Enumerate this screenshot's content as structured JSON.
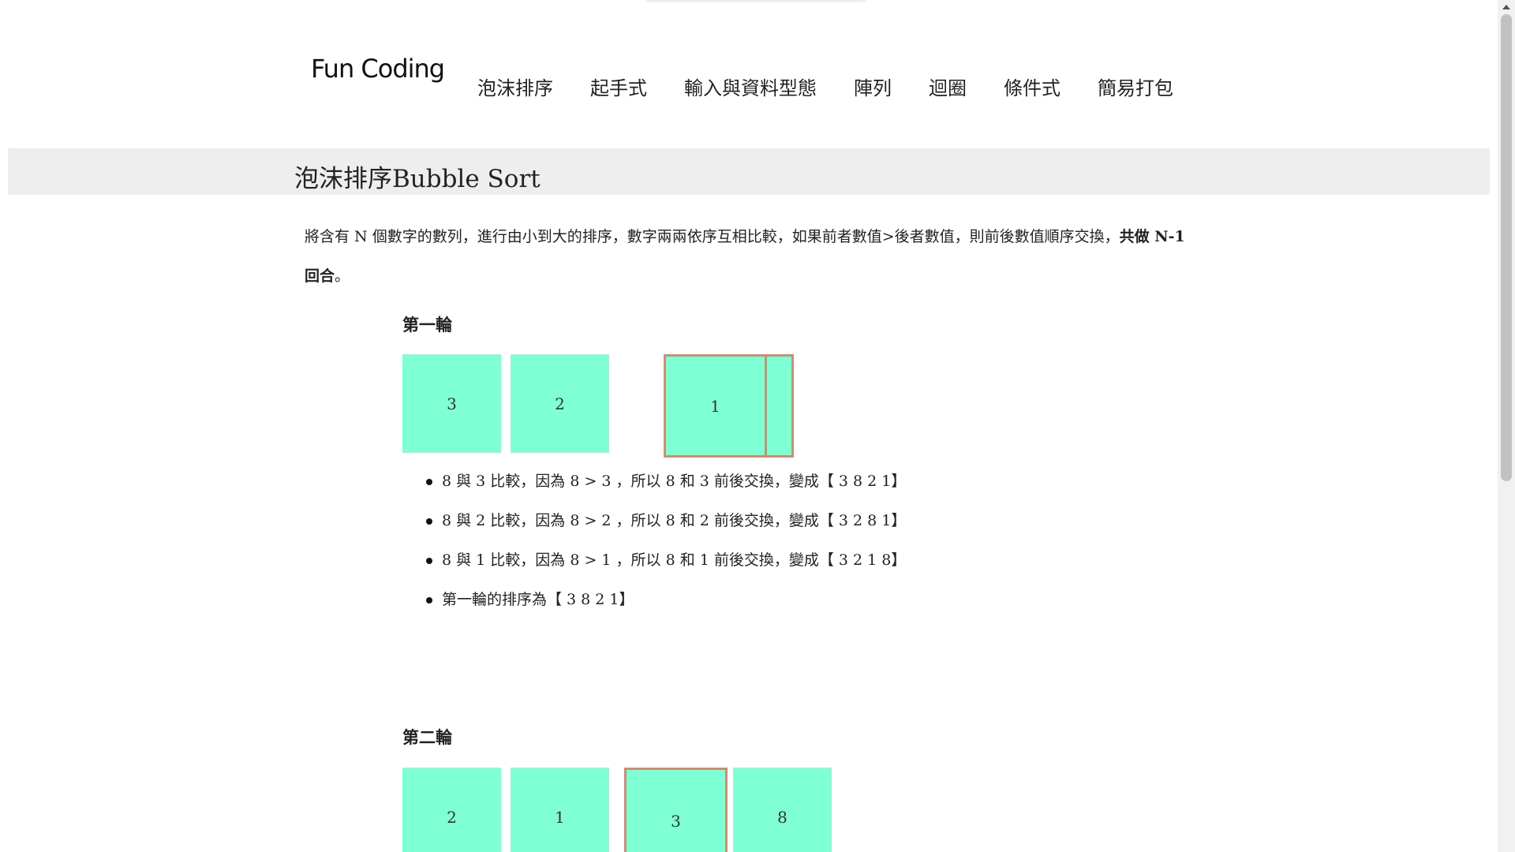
{
  "header": {
    "logo": "Fun Coding",
    "nav": [
      "泡沫排序",
      "起手式",
      "輸入與資料型態",
      "陣列",
      "迴圈",
      "條件式",
      "簡易打包"
    ]
  },
  "title": "泡沫排序Bubble Sort",
  "intro": {
    "text": "將含有 N 個數字的數列，進行由小到大的排序，數字兩兩依序互相比較，如果前者數值>後者數值，則前後數值順序交換，",
    "bold": "共做 N-1 回合",
    "end": "。"
  },
  "round1": {
    "heading": "第一輪",
    "boxes": [
      "3",
      "2",
      "1"
    ],
    "steps": [
      "8 與 3 比較，因為 8 > 3 ，所以 8 和 3 前後交換，變成【 3 8 2 1】",
      "8 與 2 比較，因為 8 > 2 ，所以 8 和 2 前後交換，變成【 3 2 8 1】",
      "8 與 1 比較，因為 8 > 1 ，所以 8 和 1 前後交換，變成【 3 2 1 8】",
      "第一輪的排序為【 3 8 2 1】"
    ]
  },
  "round2": {
    "heading": "第二輪",
    "boxes": [
      "2",
      "1",
      "3",
      "8"
    ]
  },
  "colors": {
    "box_fill": "#7fffd4",
    "highlight_border": "#f08060",
    "title_bar": "#eeeeee"
  }
}
